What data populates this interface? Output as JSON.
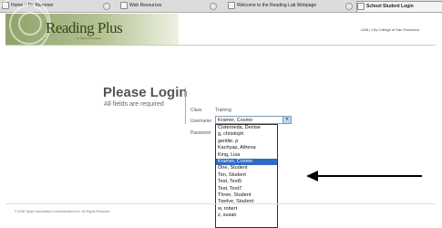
{
  "tabs": [
    {
      "label": "Home :: Dr. Klemmer"
    },
    {
      "label": "Web Resources"
    },
    {
      "label": "Welcome to the Reading Lab Webpage"
    },
    {
      "label": "School Student Login"
    }
  ],
  "header": {
    "logo": "Reading Plus",
    "logo_sub": "by Taylor Associates",
    "org": "LAM | City College of San Francisco"
  },
  "login": {
    "title": "Please Login",
    "subtitle": "All fields are required",
    "class_label": "Class",
    "class_value": "Training",
    "username_label": "Username",
    "username_value": "Kramer, Cosmo",
    "password_label": "Password"
  },
  "dropdown": {
    "selected_index": 5,
    "options": [
      "Cisterneda, Denise",
      "g, christoph",
      "gentile, p",
      "Kachyap, Athena",
      "King, Lisa",
      "Kramer, Cosmo",
      "One, Student",
      "Ten, Student",
      "Test, Test5",
      "Test, Test7",
      "Three, Student",
      "Twelve, Student",
      "w, robert",
      "z, susan"
    ]
  },
  "footer": {
    "text": "© 2008 Taylor Associates/Communications Inc. All Rights Reserved."
  }
}
